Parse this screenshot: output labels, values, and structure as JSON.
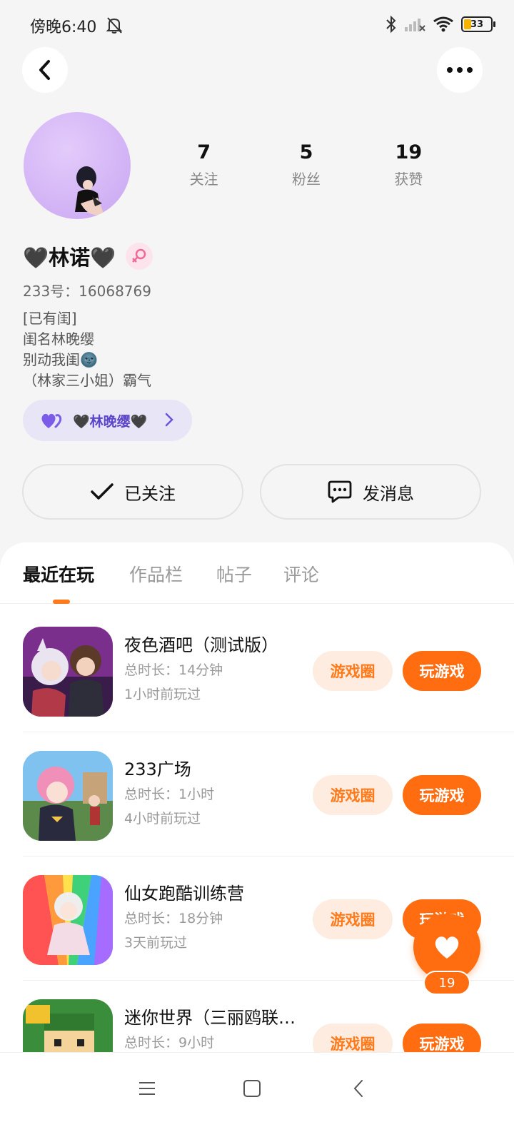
{
  "status_bar": {
    "time": "傍晚6:40",
    "battery": "33"
  },
  "profile": {
    "stats": [
      {
        "num": "7",
        "label": "关注"
      },
      {
        "num": "5",
        "label": "粉丝"
      },
      {
        "num": "19",
        "label": "获赞"
      }
    ],
    "nickname": "🖤林诺🖤",
    "user_id": "233号：16068769",
    "bio": [
      "[已有闺]",
      "闺名林晚缨",
      "别动我闺🌚",
      "（林家三小姐）霸气"
    ],
    "couple_name": "🖤林晚缨🖤"
  },
  "actions": {
    "follow_label": "已关注",
    "message_label": "发消息"
  },
  "tabs": [
    "最近在玩",
    "作品栏",
    "帖子",
    "评论"
  ],
  "games": [
    {
      "name": "夜色酒吧（测试版）",
      "duration": "总时长：14分钟",
      "last_played": "1小时前玩过",
      "circle_label": "游戏圈",
      "play_label": "玩游戏"
    },
    {
      "name": "233广场",
      "duration": "总时长：1小时",
      "last_played": "4小时前玩过",
      "circle_label": "游戏圈",
      "play_label": "玩游戏"
    },
    {
      "name": "仙女跑酷训练营",
      "duration": "总时长：18分钟",
      "last_played": "3天前玩过",
      "circle_label": "游戏圈",
      "play_label": "玩游戏"
    },
    {
      "name": "迷你世界（三丽鸥联…",
      "duration": "总时长：9小时",
      "last_played": "",
      "circle_label": "游戏圈",
      "play_label": "玩游戏"
    }
  ],
  "like_fab": {
    "count": "19"
  },
  "colors": {
    "accent": "#ff6d10",
    "accent_light": "#ffece0",
    "couple": "#5a46c9"
  }
}
